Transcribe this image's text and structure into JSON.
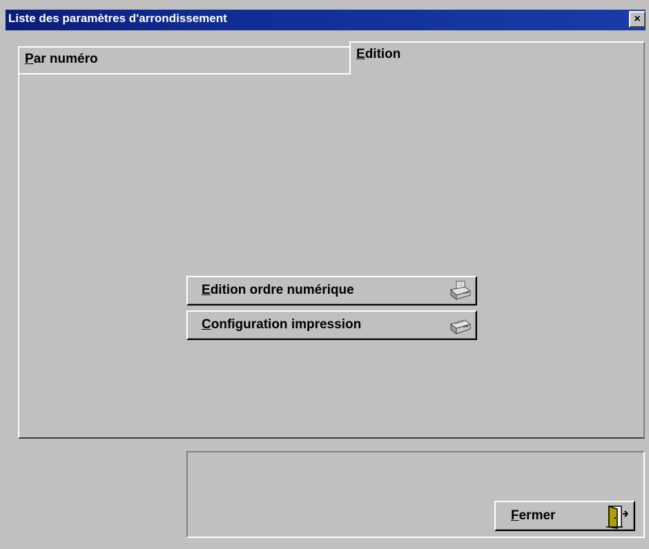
{
  "window": {
    "title": "Liste des paramètres d'arrondissement",
    "close_label": "×"
  },
  "tabs": [
    {
      "label": "Par numéro",
      "active": false
    },
    {
      "label": "Edition",
      "active": true
    }
  ],
  "edition_panel": {
    "buttons": [
      {
        "label": "Edition ordre numérique",
        "icon": "printer-icon"
      },
      {
        "label": "Configuration impression",
        "icon": "printer-icon"
      }
    ]
  },
  "footer": {
    "close_button_label": "Fermer",
    "close_button_icon": "exit-door-icon"
  }
}
